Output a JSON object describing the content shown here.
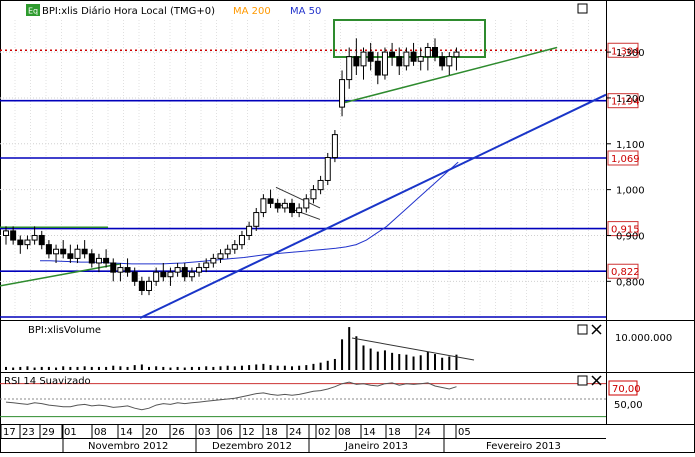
{
  "main_panel": {
    "title": "BPI:xlis Diário Hora Local (TMG+0)",
    "ma200_label": "MA 200",
    "ma50_label": "MA 50",
    "symbol_badge": "Eq",
    "colors": {
      "ma200": "#ff9900",
      "ma50": "#2233cc"
    }
  },
  "volume_panel": {
    "title": "BPI:xlisVolume",
    "axis_label": "10.000.000"
  },
  "rsi_panel": {
    "title": "RSI 14 Suavizado",
    "level_label": "70,00",
    "mid_label": "50,00"
  },
  "price_axis": {
    "ticks": [
      "1,300",
      "1,200",
      "1,100",
      "1,000",
      "0,900",
      "0,800"
    ],
    "tick_values": [
      1.3,
      1.2,
      1.1,
      1.0,
      0.9,
      0.8
    ],
    "ylim": [
      0.72,
      1.37
    ]
  },
  "price_levels": [
    {
      "label": "1,304",
      "value": 1.304,
      "style": "dotted",
      "color": "#cc0000"
    },
    {
      "label": "1,194",
      "value": 1.194,
      "style": "solid",
      "color": "#0000bb"
    },
    {
      "label": "1,069",
      "value": 1.069,
      "style": "solid",
      "color": "#0000bb"
    },
    {
      "label": "0,915",
      "value": 0.915,
      "style": "solid",
      "color": "#0000bb"
    },
    {
      "label": "0,822",
      "value": 0.822,
      "style": "solid",
      "color": "#0000bb"
    }
  ],
  "x_axis": {
    "day_labels": [
      "17",
      "23",
      "29",
      "01",
      "08",
      "14",
      "20",
      "26",
      "03",
      "06",
      "12",
      "18",
      "24",
      "02",
      "08",
      "14",
      "18",
      "24",
      "05"
    ],
    "month_labels": [
      "Novembro 2012",
      "Dezembro 2012",
      "Janeiro 2013",
      "Fevereiro 2013"
    ]
  },
  "chart_data": {
    "type": "candlestick",
    "title": "BPI:xlis Diário Hora Local (TMG+0)",
    "candles": [
      [
        0.9,
        0.92,
        0.88,
        0.91
      ],
      [
        0.91,
        0.92,
        0.88,
        0.89
      ],
      [
        0.89,
        0.9,
        0.86,
        0.88
      ],
      [
        0.88,
        0.9,
        0.87,
        0.89
      ],
      [
        0.89,
        0.92,
        0.88,
        0.9
      ],
      [
        0.9,
        0.91,
        0.87,
        0.88
      ],
      [
        0.88,
        0.89,
        0.85,
        0.86
      ],
      [
        0.86,
        0.88,
        0.84,
        0.87
      ],
      [
        0.87,
        0.89,
        0.85,
        0.86
      ],
      [
        0.86,
        0.88,
        0.84,
        0.85
      ],
      [
        0.85,
        0.88,
        0.84,
        0.87
      ],
      [
        0.87,
        0.89,
        0.85,
        0.86
      ],
      [
        0.86,
        0.87,
        0.83,
        0.84
      ],
      [
        0.84,
        0.86,
        0.82,
        0.85
      ],
      [
        0.85,
        0.87,
        0.83,
        0.84
      ],
      [
        0.84,
        0.85,
        0.8,
        0.82
      ],
      [
        0.82,
        0.84,
        0.8,
        0.83
      ],
      [
        0.83,
        0.85,
        0.81,
        0.82
      ],
      [
        0.82,
        0.83,
        0.79,
        0.8
      ],
      [
        0.8,
        0.81,
        0.77,
        0.78
      ],
      [
        0.78,
        0.81,
        0.77,
        0.8
      ],
      [
        0.8,
        0.83,
        0.79,
        0.82
      ],
      [
        0.82,
        0.84,
        0.8,
        0.81
      ],
      [
        0.81,
        0.83,
        0.79,
        0.82
      ],
      [
        0.82,
        0.84,
        0.81,
        0.83
      ],
      [
        0.83,
        0.84,
        0.8,
        0.81
      ],
      [
        0.81,
        0.83,
        0.8,
        0.82
      ],
      [
        0.82,
        0.84,
        0.81,
        0.83
      ],
      [
        0.83,
        0.85,
        0.82,
        0.84
      ],
      [
        0.84,
        0.86,
        0.83,
        0.85
      ],
      [
        0.85,
        0.87,
        0.84,
        0.86
      ],
      [
        0.86,
        0.88,
        0.85,
        0.87
      ],
      [
        0.87,
        0.89,
        0.86,
        0.88
      ],
      [
        0.88,
        0.91,
        0.87,
        0.9
      ],
      [
        0.9,
        0.93,
        0.89,
        0.92
      ],
      [
        0.92,
        0.96,
        0.91,
        0.95
      ],
      [
        0.95,
        0.99,
        0.94,
        0.98
      ],
      [
        0.98,
        1.0,
        0.96,
        0.97
      ],
      [
        0.97,
        0.98,
        0.95,
        0.96
      ],
      [
        0.96,
        0.98,
        0.95,
        0.97
      ],
      [
        0.97,
        0.98,
        0.94,
        0.95
      ],
      [
        0.95,
        0.97,
        0.94,
        0.96
      ],
      [
        0.96,
        0.99,
        0.95,
        0.98
      ],
      [
        0.98,
        1.01,
        0.97,
        1.0
      ],
      [
        1.0,
        1.03,
        0.99,
        1.02
      ],
      [
        1.02,
        1.08,
        1.01,
        1.07
      ],
      [
        1.07,
        1.13,
        1.06,
        1.12
      ],
      [
        1.18,
        1.26,
        1.16,
        1.24
      ],
      [
        1.24,
        1.31,
        1.22,
        1.29
      ],
      [
        1.29,
        1.33,
        1.25,
        1.27
      ],
      [
        1.27,
        1.31,
        1.24,
        1.3
      ],
      [
        1.3,
        1.32,
        1.26,
        1.28
      ],
      [
        1.28,
        1.3,
        1.23,
        1.25
      ],
      [
        1.25,
        1.31,
        1.24,
        1.3
      ],
      [
        1.3,
        1.32,
        1.27,
        1.29
      ],
      [
        1.29,
        1.31,
        1.25,
        1.27
      ],
      [
        1.27,
        1.31,
        1.26,
        1.3
      ],
      [
        1.3,
        1.32,
        1.27,
        1.28
      ],
      [
        1.28,
        1.31,
        1.26,
        1.29
      ],
      [
        1.29,
        1.32,
        1.26,
        1.31
      ],
      [
        1.31,
        1.33,
        1.28,
        1.29
      ],
      [
        1.29,
        1.3,
        1.26,
        1.27
      ],
      [
        1.27,
        1.3,
        1.25,
        1.29
      ],
      [
        1.29,
        1.31,
        1.26,
        1.3
      ]
    ],
    "ma200_value": 1.304,
    "ma50": [
      0.845,
      0.845,
      0.844,
      0.843,
      0.842,
      0.842,
      0.841,
      0.84,
      0.839,
      0.838,
      0.838,
      0.838,
      0.838,
      0.839,
      0.84,
      0.842,
      0.844,
      0.846,
      0.848,
      0.85,
      0.852,
      0.855,
      0.858,
      0.86,
      0.862,
      0.864,
      0.866,
      0.868,
      0.87,
      0.872,
      0.875,
      0.88,
      0.89,
      0.905,
      0.92,
      0.94,
      0.96,
      0.98,
      1.0,
      1.02,
      1.04,
      1.06
    ],
    "volume_axis": "10.000.000",
    "volume": [
      0.05,
      0.04,
      0.05,
      0.06,
      0.04,
      0.05,
      0.05,
      0.04,
      0.06,
      0.05,
      0.05,
      0.06,
      0.05,
      0.05,
      0.05,
      0.07,
      0.06,
      0.05,
      0.08,
      0.09,
      0.05,
      0.06,
      0.05,
      0.04,
      0.05,
      0.04,
      0.05,
      0.05,
      0.06,
      0.05,
      0.06,
      0.07,
      0.06,
      0.07,
      0.08,
      0.09,
      0.1,
      0.08,
      0.07,
      0.07,
      0.06,
      0.07,
      0.08,
      0.1,
      0.12,
      0.15,
      0.18,
      0.5,
      0.7,
      0.55,
      0.4,
      0.35,
      0.3,
      0.32,
      0.28,
      0.26,
      0.25,
      0.22,
      0.24,
      0.3,
      0.26,
      0.2,
      0.22,
      0.25
    ],
    "rsi": [
      46,
      45,
      44,
      43,
      45,
      44,
      42,
      41,
      40,
      40,
      42,
      43,
      41,
      42,
      41,
      39,
      40,
      41,
      38,
      36,
      38,
      42,
      44,
      43,
      45,
      44,
      45,
      46,
      47,
      48,
      49,
      50,
      51,
      53,
      55,
      57,
      58,
      56,
      55,
      56,
      55,
      56,
      58,
      60,
      61,
      63,
      66,
      70,
      72,
      69,
      70,
      68,
      67,
      70,
      71,
      68,
      70,
      69,
      70,
      71,
      67,
      65,
      63,
      66
    ],
    "rsi_levels": [
      70,
      50
    ],
    "rsi_label": "70,00",
    "ylim": [
      0.72,
      1.37
    ]
  }
}
